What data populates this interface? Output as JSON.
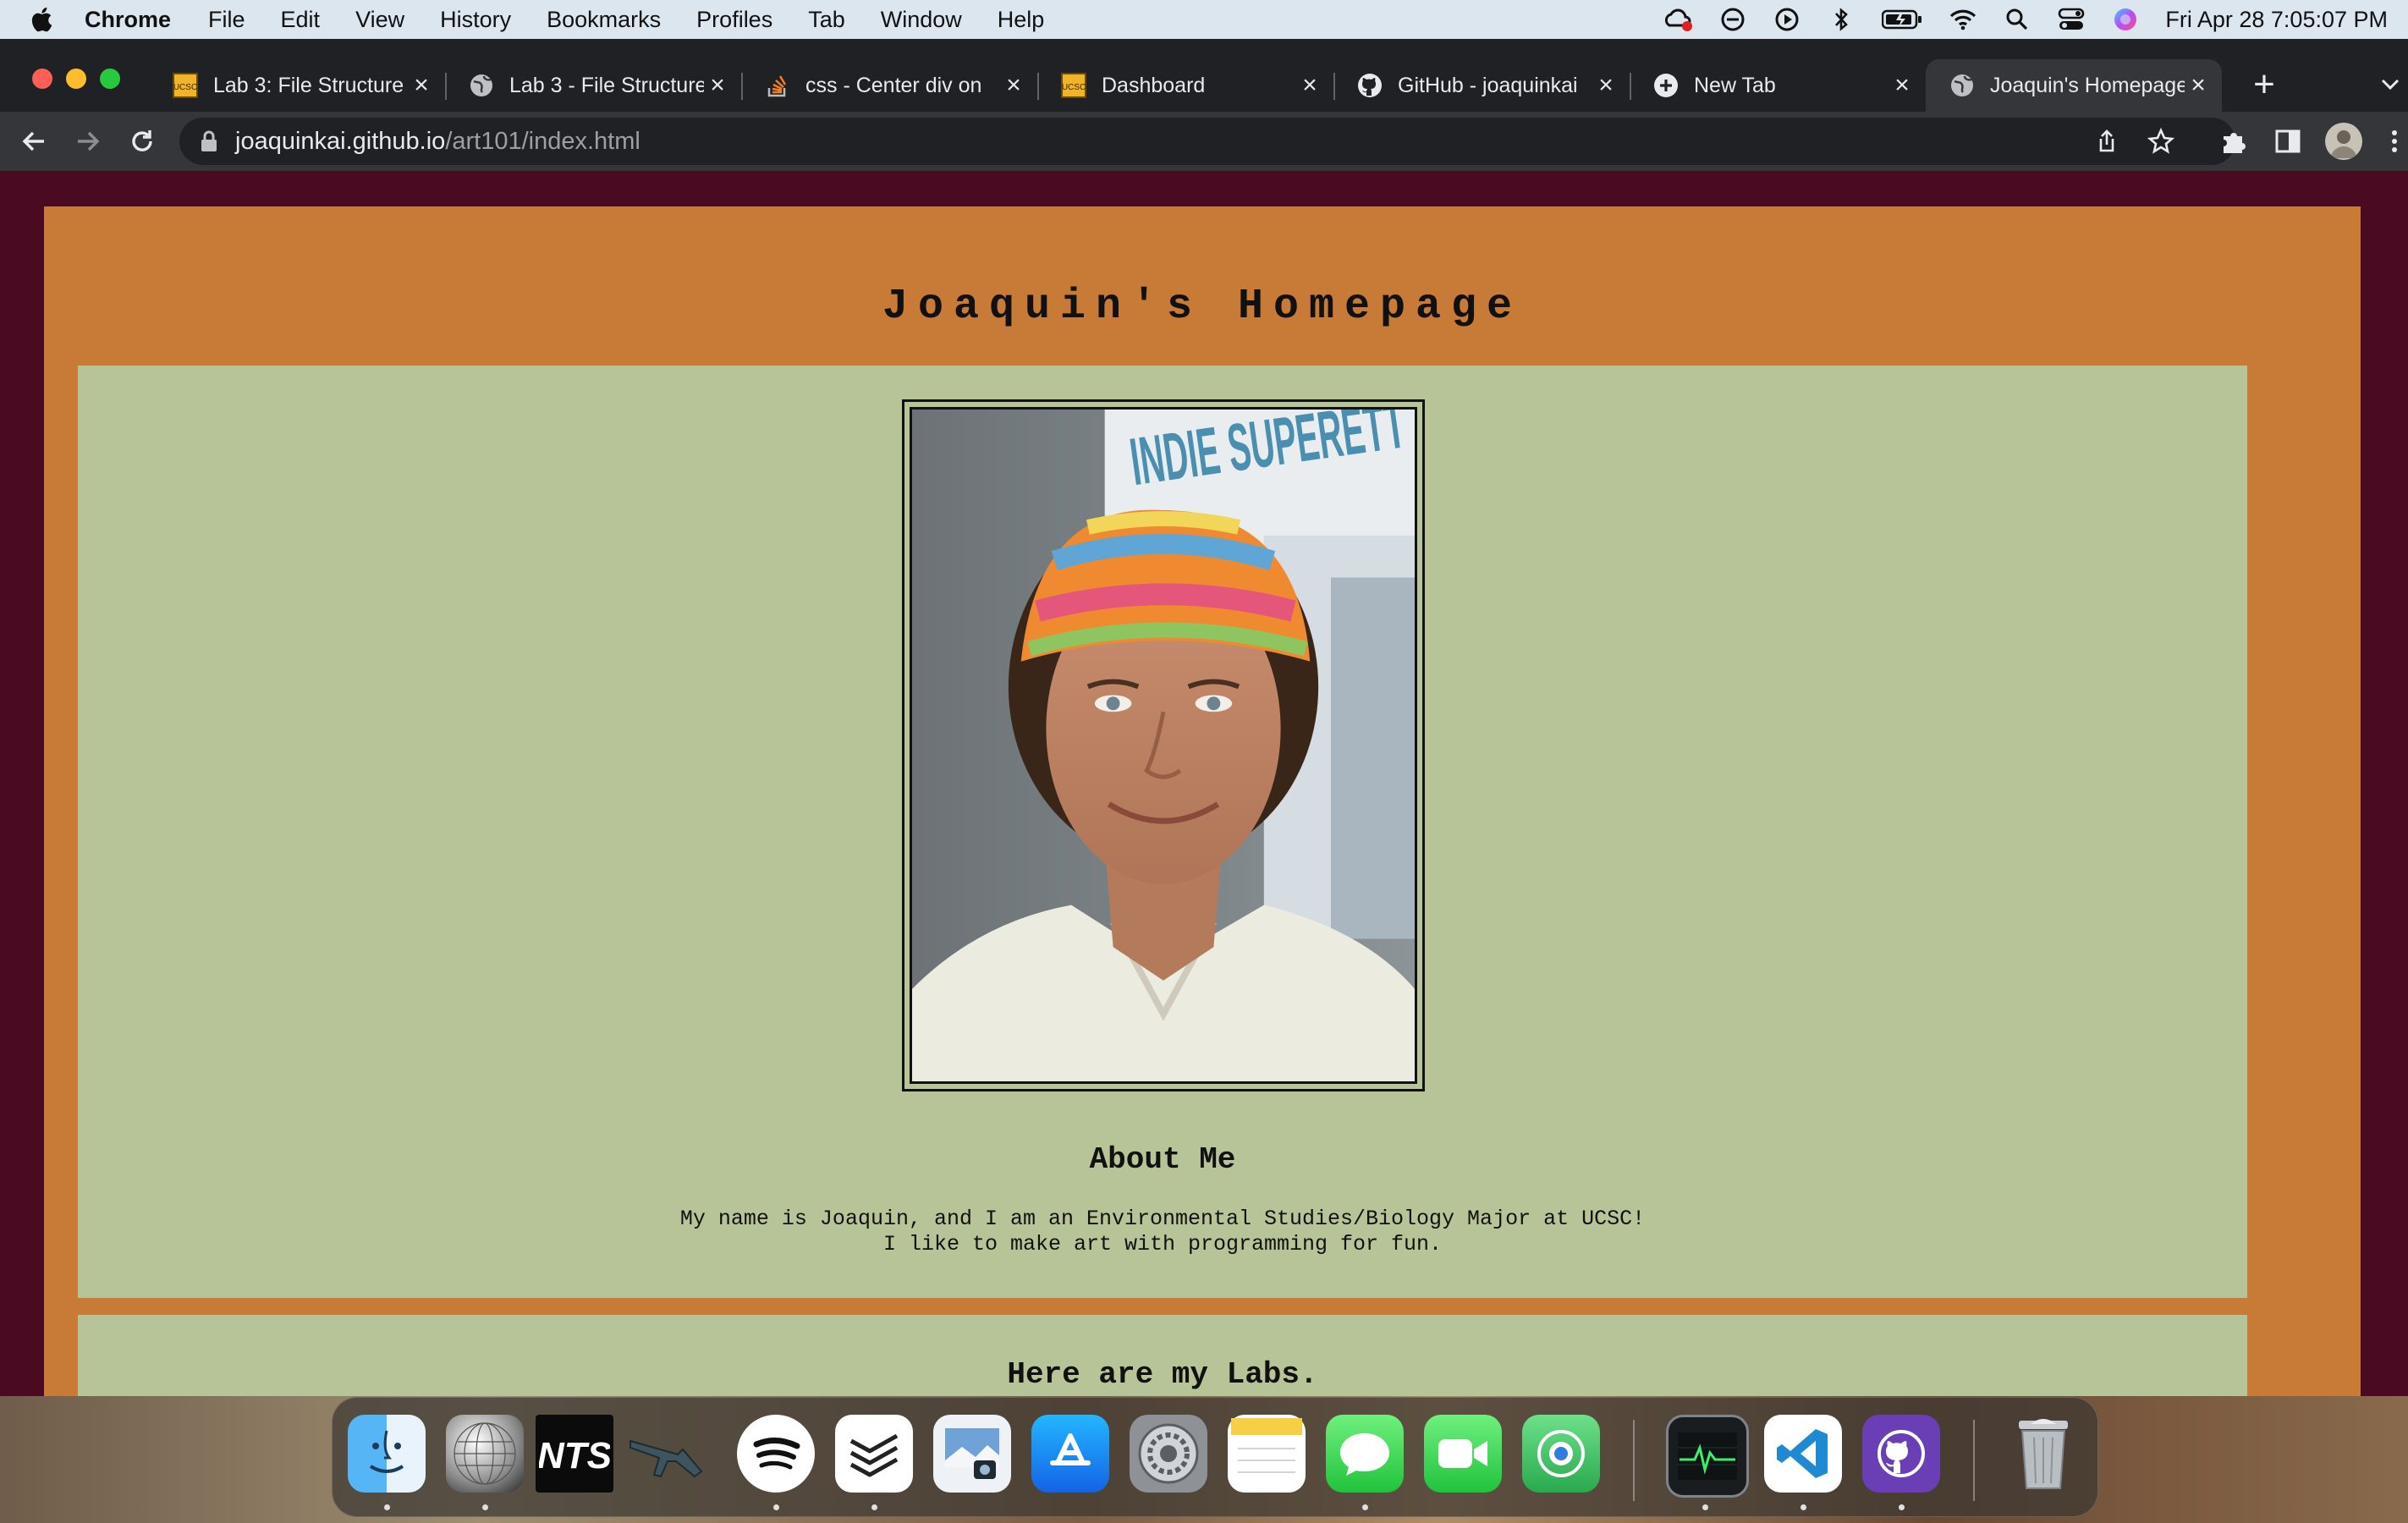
{
  "menubar": {
    "app_name": "Chrome",
    "menus": [
      "File",
      "Edit",
      "View",
      "History",
      "Bookmarks",
      "Profiles",
      "Tab",
      "Window",
      "Help"
    ],
    "clock": "Fri Apr 28  7:05:07 PM",
    "status_icons": [
      "creative-cloud-icon",
      "focus-icon",
      "play-icon",
      "bluetooth-icon",
      "battery-icon",
      "wifi-icon",
      "spotlight-search-icon",
      "control-center-icon",
      "siri-icon"
    ]
  },
  "browser": {
    "tabs": [
      {
        "label": "Lab 3: File Structure",
        "icon": "ucsc-favicon"
      },
      {
        "label": "Lab 3 - File Structure",
        "icon": "globe-icon"
      },
      {
        "label": "css - Center div on",
        "icon": "stackoverflow-icon"
      },
      {
        "label": "Dashboard",
        "icon": "ucsc-favicon"
      },
      {
        "label": "GitHub - joaquinkai",
        "icon": "github-icon"
      },
      {
        "label": "New Tab",
        "icon": "chrome-newtab-icon"
      },
      {
        "label": "Joaquin's Homepage",
        "icon": "globe-icon",
        "active": true
      }
    ],
    "address": {
      "host": "joaquinkai.github.io",
      "path": "/art101/index.html"
    }
  },
  "page": {
    "title": "Joaquin's Homepage",
    "about_heading": "About Me",
    "about_line_1": "My name is Joaquin, and I am an Environmental Studies/Biology Major at UCSC!",
    "about_line_2": "I like to make art with programming for fun.",
    "labs_heading": "Here are my Labs.",
    "photo_sign_text": "INDIE SUPERETT",
    "colors": {
      "page_bg": "#4a0b22",
      "frame": "#c87a37",
      "panel": "#b6c497"
    }
  },
  "dock": {
    "apps": [
      "Finder",
      "Disco Ball",
      "NTS Radio",
      "Rifle",
      "Spotify",
      "Todoist",
      "Preview",
      "App Store",
      "System Settings",
      "Notes",
      "Messages",
      "FaceTime",
      "Find My",
      "Activity Monitor",
      "Visual Studio Code",
      "GitHub Desktop",
      "Trash"
    ]
  }
}
